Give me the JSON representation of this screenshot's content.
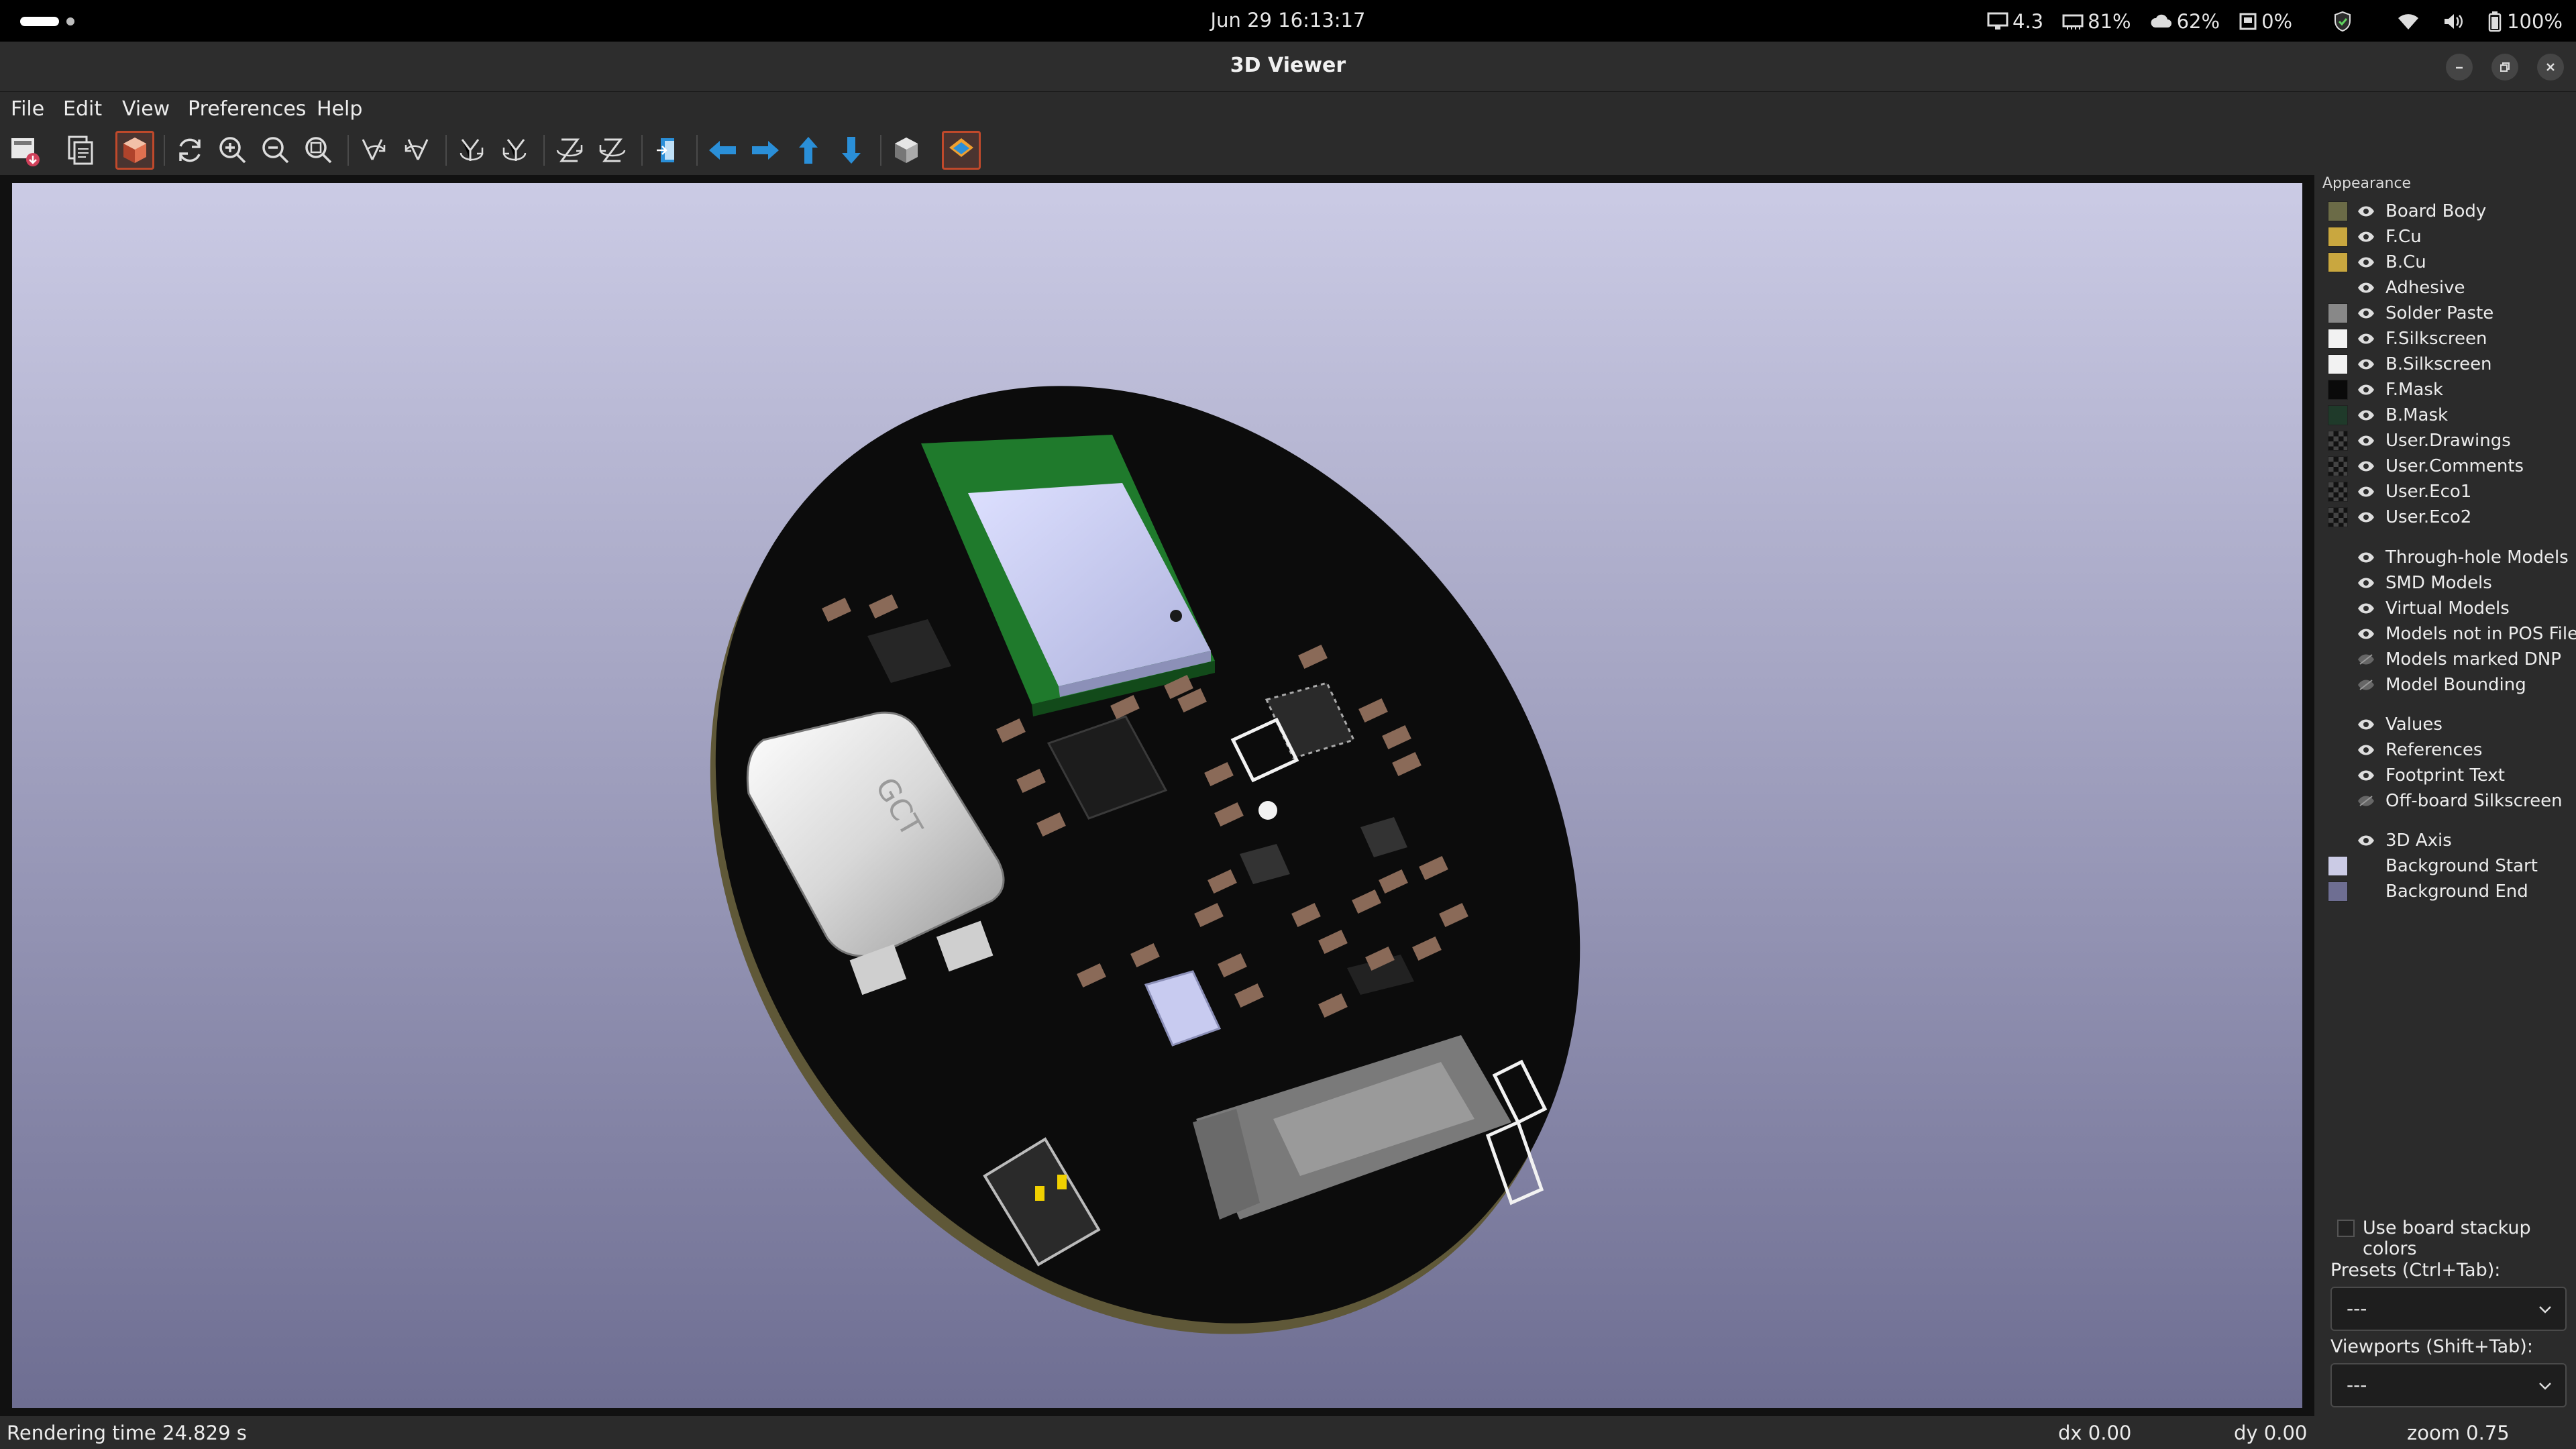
{
  "system_bar": {
    "datetime": "Jun 29  16:13:17",
    "load": "4.3",
    "memory": "81%",
    "cloud": "62%",
    "disk": "0%",
    "battery": "100%"
  },
  "window": {
    "title": "3D Viewer"
  },
  "menu": {
    "file": "File",
    "edit": "Edit",
    "view": "View",
    "preferences": "Preferences",
    "help": "Help"
  },
  "toolbar": {
    "icons": [
      "export-icon",
      "copy-icon",
      "raytrace-icon",
      "reload-icon",
      "zoom-in-icon",
      "zoom-out-icon",
      "zoom-fit-icon",
      "rotate-x-cw-icon",
      "rotate-x-ccw-icon",
      "rotate-y-cw-icon",
      "rotate-y-ccw-icon",
      "rotate-z-cw-icon",
      "rotate-z-ccw-icon",
      "flip-board-icon",
      "pan-left-icon",
      "pan-right-icon",
      "pan-up-icon",
      "pan-down-icon",
      "ortho-icon",
      "layers-icon"
    ]
  },
  "appearance": {
    "title": "Appearance",
    "layers": [
      {
        "label": "Board Body",
        "color": "#6b6b47"
      },
      {
        "label": "F.Cu",
        "color": "#c9a73f"
      },
      {
        "label": "B.Cu",
        "color": "#c9a73f"
      },
      {
        "label": "Adhesive",
        "color": ""
      },
      {
        "label": "Solder Paste",
        "color": "#888888"
      },
      {
        "label": "F.Silkscreen",
        "color": "#f2f2f2"
      },
      {
        "label": "B.Silkscreen",
        "color": "#f2f2f2"
      },
      {
        "label": "F.Mask",
        "color": "#0a0a0a"
      },
      {
        "label": "B.Mask",
        "color": "#1f3a2a"
      },
      {
        "label": "User.Drawings",
        "color": "checker"
      },
      {
        "label": "User.Comments",
        "color": "checker"
      },
      {
        "label": "User.Eco1",
        "color": "checker"
      },
      {
        "label": "User.Eco2",
        "color": "checker"
      }
    ],
    "models": [
      {
        "label": "Through-hole Models",
        "visible": true
      },
      {
        "label": "SMD Models",
        "visible": true
      },
      {
        "label": "Virtual Models",
        "visible": true
      },
      {
        "label": "Models not in POS File",
        "visible": true
      },
      {
        "label": "Models marked DNP",
        "visible": false
      },
      {
        "label": "Model Bounding",
        "visible": false
      }
    ],
    "text": [
      {
        "label": "Values",
        "visible": true
      },
      {
        "label": "References",
        "visible": true
      },
      {
        "label": "Footprint Text",
        "visible": true
      },
      {
        "label": "Off-board Silkscreen",
        "visible": false
      }
    ],
    "misc": [
      {
        "label": "3D Axis",
        "color": ""
      },
      {
        "label": "Background Start",
        "color": "#cbcbe5"
      },
      {
        "label": "Background End",
        "color": "#6e6e92"
      }
    ],
    "use_stackup_colors": "Use board stackup colors",
    "presets_label": "Presets (Ctrl+Tab):",
    "presets_value": "---",
    "viewports_label": "Viewports (Shift+Tab):",
    "viewports_value": "---"
  },
  "scene": {
    "connector_silk": "GCT"
  },
  "status": {
    "render_time": "Rendering time 24.829 s",
    "dx": "dx 0.00",
    "dy": "dy 0.00",
    "zoom": "zoom 0.75"
  }
}
